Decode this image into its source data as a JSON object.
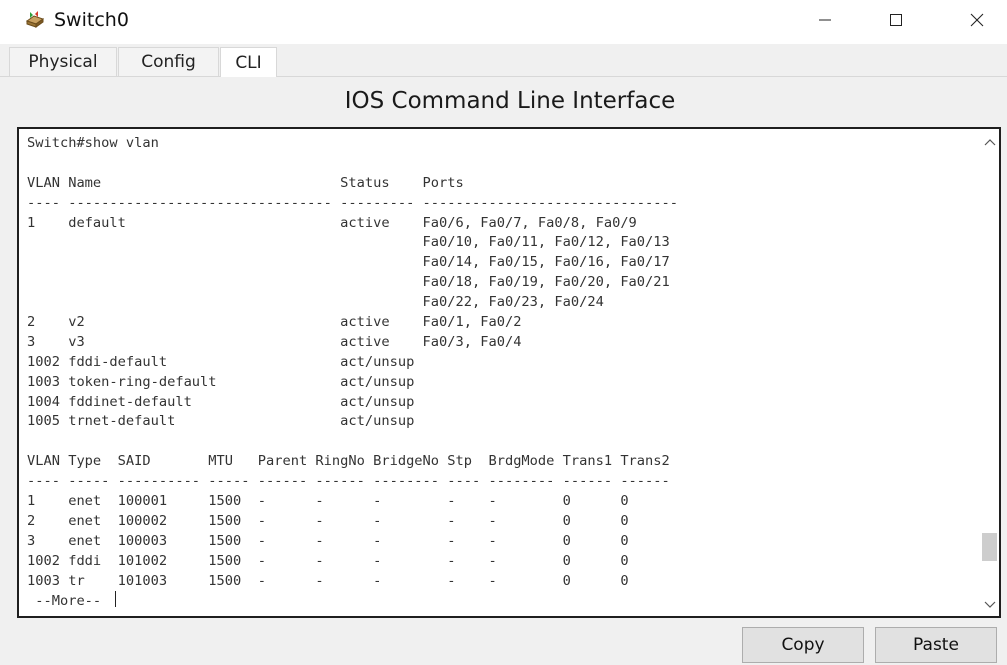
{
  "window": {
    "title": "Switch0",
    "icon": "switch-device-icon"
  },
  "tabs": [
    {
      "label": "Physical",
      "active": false
    },
    {
      "label": "Config",
      "active": false
    },
    {
      "label": "CLI",
      "active": true
    }
  ],
  "heading": "IOS Command Line Interface",
  "terminal": {
    "lines": [
      "Switch#show vlan",
      "",
      "VLAN Name                             Status    Ports",
      "---- -------------------------------- --------- -------------------------------",
      "1    default                          active    Fa0/6, Fa0/7, Fa0/8, Fa0/9",
      "                                                Fa0/10, Fa0/11, Fa0/12, Fa0/13",
      "                                                Fa0/14, Fa0/15, Fa0/16, Fa0/17",
      "                                                Fa0/18, Fa0/19, Fa0/20, Fa0/21",
      "                                                Fa0/22, Fa0/23, Fa0/24",
      "2    v2                               active    Fa0/1, Fa0/2",
      "3    v3                               active    Fa0/3, Fa0/4",
      "1002 fddi-default                     act/unsup",
      "1003 token-ring-default               act/unsup",
      "1004 fddinet-default                  act/unsup",
      "1005 trnet-default                    act/unsup",
      "",
      "VLAN Type  SAID       MTU   Parent RingNo BridgeNo Stp  BrdgMode Trans1 Trans2",
      "---- ----- ---------- ----- ------ ------ -------- ---- -------- ------ ------",
      "1    enet  100001     1500  -      -      -        -    -        0      0",
      "2    enet  100002     1500  -      -      -        -    -        0      0",
      "3    enet  100003     1500  -      -      -        -    -        0      0",
      "1002 fddi  101002     1500  -      -      -        -    -        0      0",
      "1003 tr    101003     1500  -      -      -        -    -        0      0"
    ],
    "more_prompt": " --More-- ",
    "scroll_position": 0.92
  },
  "buttons": {
    "copy": "Copy",
    "paste": "Paste"
  },
  "colors": {
    "window_bg": "#f0f0f0",
    "terminal_border": "#1f1f1f",
    "terminal_text": "#333333",
    "button_bg": "#e1e1e1"
  }
}
